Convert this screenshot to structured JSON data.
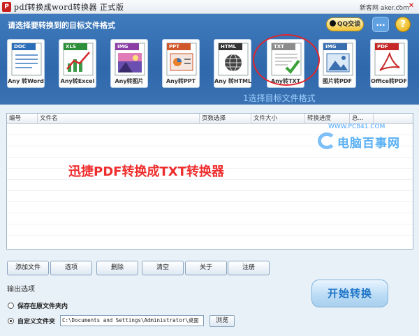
{
  "window": {
    "title": "pdf转换成word转换器 正式版",
    "watermark": "新客网 aker.com",
    "app_icon": "pdf-app-icon",
    "controls": [
      "minimize-icon",
      "close-icon"
    ]
  },
  "header": {
    "instruction": "请选择要转换到的目标文件格式",
    "qq_label": "QQ交谈",
    "chat_icon": "chat-bubble-icon",
    "help_icon": "help-icon"
  },
  "formats": [
    {
      "tag": "DOC",
      "label": "Any 转Word",
      "color": "#2a6db8",
      "icon": "word-doc-icon"
    },
    {
      "tag": "XLS",
      "label": "Any转Excel",
      "color": "#2d8f3a",
      "icon": "excel-chart-icon"
    },
    {
      "tag": "IMG",
      "label": "Any转图片",
      "color": "#8b3fa6",
      "icon": "image-icon"
    },
    {
      "tag": "PPT",
      "label": "Any转PPT",
      "color": "#d0572a",
      "icon": "ppt-icon"
    },
    {
      "tag": "HTML",
      "label": "Any 转HTML",
      "color": "#333333",
      "icon": "html-globe-icon"
    },
    {
      "tag": "TXT",
      "label": "Any转TXT",
      "color": "#8c8c8c",
      "icon": "txt-check-icon"
    },
    {
      "tag": "IMG",
      "label": "图片转PDF",
      "color": "#3a6fb0",
      "icon": "image-to-pdf-icon"
    },
    {
      "tag": "PDF",
      "label": "Office转PDF",
      "color": "#c62828",
      "icon": "office-to-pdf-icon"
    }
  ],
  "annotation": "1选择目标文件格式",
  "table": {
    "columns": [
      "编号",
      "文件名",
      "页数选择",
      "文件大小",
      "转换进度",
      "总..."
    ],
    "rows": []
  },
  "watermarks": {
    "site": "WWW.PC841.COM",
    "logo_text": "电脑百事网",
    "heading": "迅捷PDF转换成TXT转换器"
  },
  "actions": [
    "添加文件",
    "选项",
    "删除",
    "清空",
    "关于",
    "注册"
  ],
  "output": {
    "label": "输出选项",
    "option_original": "保存在原文件夹内",
    "option_custom": "自定义文件夹",
    "selected": "custom",
    "path": "C:\\Documents and Settings\\Administrator\\桌面",
    "browse_label": "浏览"
  },
  "start_label": "开始转换"
}
